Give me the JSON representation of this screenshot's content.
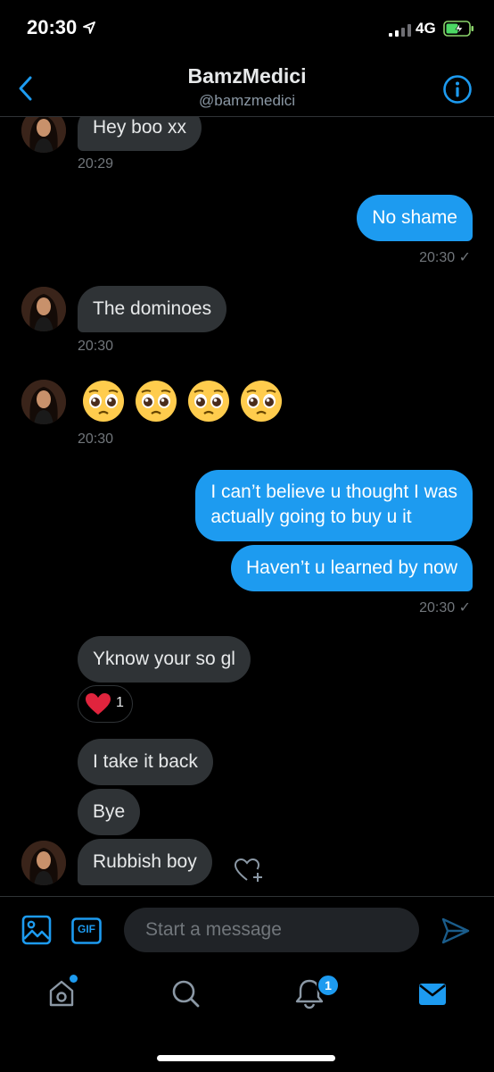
{
  "status_bar": {
    "time": "20:30",
    "network": "4G"
  },
  "header": {
    "name": "BamzMedici",
    "handle": "@bamzmedici"
  },
  "messages": [
    {
      "side": "received",
      "text": "Hey boo xx",
      "time": "20:29"
    },
    {
      "side": "sent",
      "text": "No shame",
      "time": "20:30 ✓"
    },
    {
      "side": "received",
      "text": "The dominoes",
      "time": "20:30"
    },
    {
      "side": "received",
      "text": "🥺 🥺 🥺 🥺",
      "time": "20:30"
    },
    {
      "side": "sent",
      "lines": [
        "I can’t believe u thought I was",
        "actually going to buy u it"
      ]
    },
    {
      "side": "sent",
      "text": "Haven’t u learned by now",
      "time": "20:30 ✓"
    },
    {
      "side": "received",
      "text": "Yknow your so gl",
      "reaction": {
        "icon": "heart-icon",
        "count": "1"
      }
    },
    {
      "side": "received",
      "text": "I take it back"
    },
    {
      "side": "received",
      "text": "Bye"
    },
    {
      "side": "received",
      "text": "Rubbish boy"
    }
  ],
  "composer": {
    "placeholder": "Start a message",
    "gif_label": "GIF"
  },
  "tabbar": {
    "notifications_count": "1"
  },
  "colors": {
    "accent": "#1d9bf0",
    "background": "#000000",
    "received_bubble": "#2f3336",
    "heart": "#f91880"
  }
}
